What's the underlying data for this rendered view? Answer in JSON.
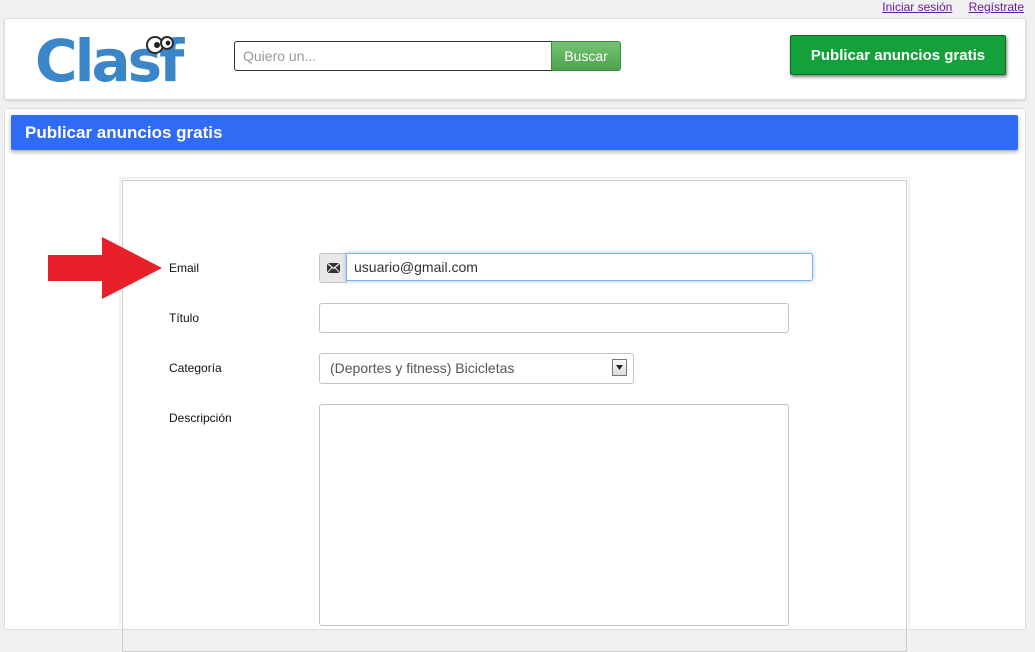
{
  "top_links": {
    "login": "Iniciar sesión",
    "register": "Regístrate"
  },
  "header": {
    "logo_text": "Clasf",
    "search": {
      "placeholder": "Quiero un...",
      "button_label": "Buscar"
    },
    "publish_button": "Publicar anuncios gratis"
  },
  "main": {
    "title": "Publicar anuncios gratis",
    "form": {
      "email": {
        "label": "Email",
        "value": "usuario@gmail.com",
        "icon": "envelope-icon"
      },
      "titulo": {
        "label": "Título",
        "value": ""
      },
      "categoria": {
        "label": "Categoría",
        "selected": "(Deportes y fitness) Bicicletas"
      },
      "descripcion": {
        "label": "Descripción",
        "value": ""
      }
    }
  },
  "colors": {
    "logo_blue": "#3a86c8",
    "title_bar": "#2f6bf4",
    "publish_green": "#14a03a",
    "search_green": "#5cb25c",
    "arrow_red": "#e8202a"
  }
}
